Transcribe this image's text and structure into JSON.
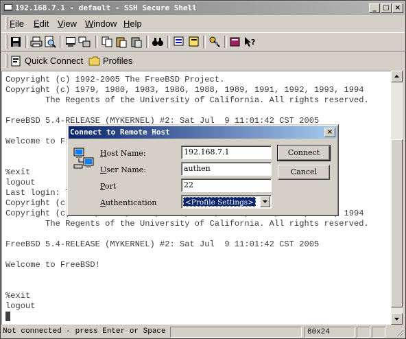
{
  "window": {
    "title": "192.168.7.1 - default - SSH Secure Shell",
    "min_symbol": "_",
    "max_symbol": "□",
    "close_symbol": "×"
  },
  "menu": [
    {
      "label": "File",
      "key": "F",
      "rest": "ile"
    },
    {
      "label": "Edit",
      "key": "E",
      "rest": "dit"
    },
    {
      "label": "View",
      "key": "V",
      "rest": "iew"
    },
    {
      "label": "Window",
      "key": "W",
      "rest": "indow"
    },
    {
      "label": "Help",
      "key": "H",
      "rest": "elp"
    }
  ],
  "toolbar": {
    "icons": [
      "save-icon",
      "print-icon",
      "print-preview-icon",
      "new-terminal-icon",
      "new-file-transfer-icon",
      "copy-icon",
      "paste-icon",
      "paste-special-icon",
      "find-icon",
      "settings-icon",
      "profile-icon",
      "keygen-icon",
      "help-book-icon",
      "context-help-icon"
    ]
  },
  "profiles_bar": {
    "quick_connect": "Quick Connect",
    "profiles": "Profiles"
  },
  "terminal": {
    "lines": [
      "Copyright (c) 1992-2005 The FreeBSD Project.",
      "Copyright (c) 1979, 1980, 1983, 1986, 1988, 1989, 1991, 1992, 1993, 1994",
      "        The Regents of the University of California. All rights reserved.",
      "",
      "FreeBSD 5.4-RELEASE (MYKERNEL) #2: Sat Jul  9 11:01:42 CST 2005",
      "",
      "Welcome to FreeBSD!",
      "",
      "",
      "%exit",
      "logout",
      "Last login: Thu Jul 14 01:30:49 2005 from 192.168.7.10",
      "Copyright (c) 1992-2005 The FreeBSD Project.",
      "Copyright (c) 1979, 1980, 1983, 1986, 1988, 1989, 1991, 1992, 1993, 1994",
      "        The Regents of the University of California. All rights reserved.",
      "",
      "FreeBSD 5.4-RELEASE (MYKERNEL) #2: Sat Jul  9 11:01:42 CST 2005",
      "",
      "Welcome to FreeBSD!",
      "",
      "",
      "%exit",
      "logout"
    ]
  },
  "dialog": {
    "title": "Connect to Remote Host",
    "host_label_key": "H",
    "host_label_rest": "ost Name:",
    "host_value": "192.168.7.1",
    "user_label_key": "U",
    "user_label_rest": "ser Name:",
    "user_value": "authen",
    "port_label_key": "P",
    "port_label_rest": "ort",
    "port_value": "22",
    "auth_label_key": "A",
    "auth_label_rest": "uthentication",
    "auth_value": "<Profile Settings>",
    "connect_label": "Connect",
    "cancel_label": "Cancel"
  },
  "status": {
    "message": "Not connected - press Enter or Space to connect",
    "size": "80x24"
  }
}
